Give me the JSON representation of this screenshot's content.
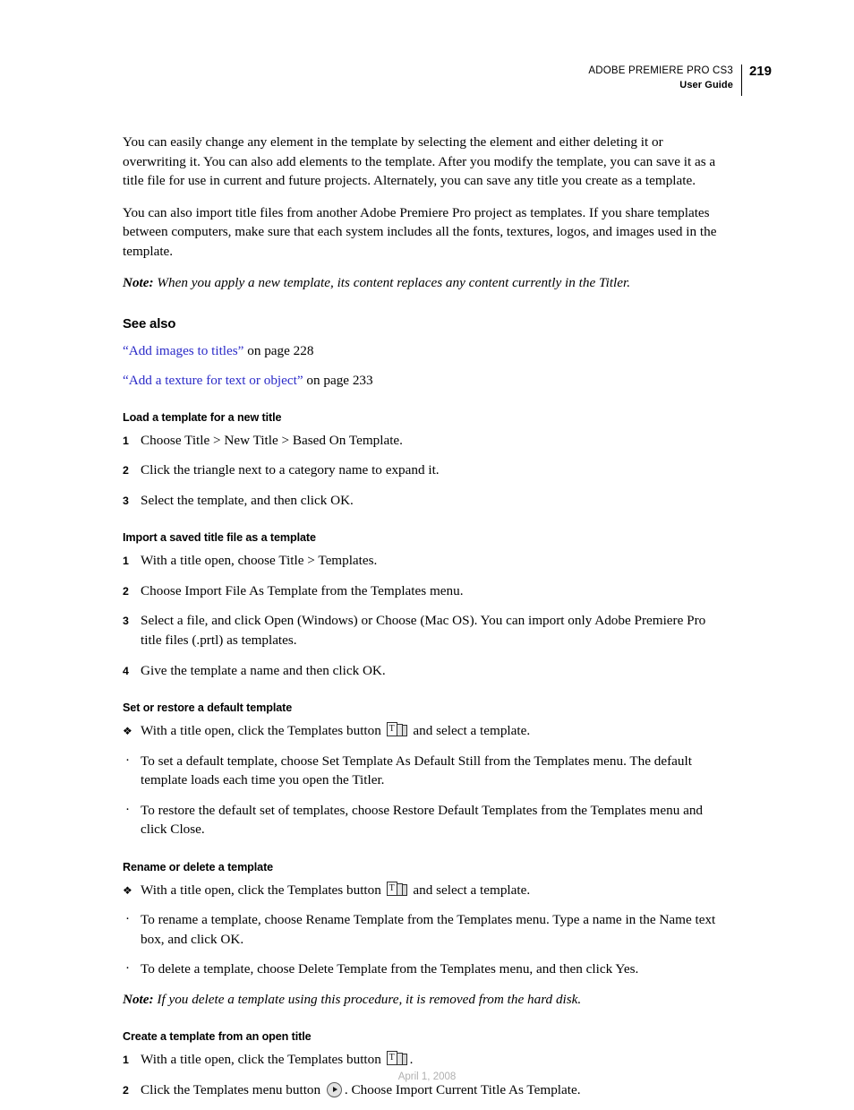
{
  "header": {
    "product": "ADOBE PREMIERE PRO CS3",
    "doc_type": "User Guide",
    "page_number": "219"
  },
  "body": {
    "paragraph_1": "You can easily change any element in the template by selecting the element and either deleting it or overwriting it. You can also add elements to the template. After you modify the template, you can save it as a title file for use in current and future projects. Alternately, you can save any title you create as a template.",
    "paragraph_2": "You can also import title files from another Adobe Premiere Pro project as templates. If you share templates between computers, make sure that each system includes all the fonts, textures, logos, and images used in the template.",
    "note_1_label": "Note:",
    "note_1_text": "When you apply a new template, its content replaces any content currently in the Titler."
  },
  "see_also": {
    "heading": "See also",
    "links": [
      {
        "open_quote": "“",
        "label": "Add images to titles",
        "close_quote": "”",
        "suffix": " on page 228"
      },
      {
        "open_quote": "“",
        "label": "Add a texture for text or object",
        "close_quote": "”",
        "suffix": " on page 233"
      }
    ]
  },
  "sections": {
    "load_template": {
      "heading": "Load a template for a new title",
      "steps": [
        {
          "num": "1",
          "text": "Choose Title > New Title > Based On Template."
        },
        {
          "num": "2",
          "text": "Click the triangle next to a category name to expand it."
        },
        {
          "num": "3",
          "text": "Select the template, and then click OK."
        }
      ]
    },
    "import_template": {
      "heading": "Import a saved title file as a template",
      "steps": [
        {
          "num": "1",
          "text": "With a title open, choose Title > Templates."
        },
        {
          "num": "2",
          "text": "Choose Import File As Template from the Templates menu."
        },
        {
          "num": "3",
          "text": "Select a file, and click Open (Windows) or Choose (Mac OS). You can import only Adobe Premiere Pro title files (.prtl) as templates."
        },
        {
          "num": "4",
          "text": "Give the template a name and then click OK."
        }
      ]
    },
    "default_template": {
      "heading": "Set or restore a default template",
      "diamond_bullet": "❖",
      "lead_text_before_icon": "With a title open, click the Templates button",
      "lead_text_after_icon": "and select a template.",
      "dot_bullet": "·",
      "bullets": [
        "To set a default template, choose Set Template As Default Still from the Templates menu. The default template loads each time you open the Titler.",
        "To restore the default set of templates, choose Restore Default Templates from the Templates menu and click Close."
      ]
    },
    "rename_delete": {
      "heading": "Rename or delete a template",
      "diamond_bullet": "❖",
      "lead_text_before_icon": "With a title open, click the Templates button",
      "lead_text_after_icon": "and select a template.",
      "dot_bullet": "·",
      "bullets": [
        "To rename a template, choose Rename Template from the Templates menu. Type a name in the Name text box, and click OK.",
        "To delete a template, choose Delete Template from the Templates menu, and then click Yes."
      ],
      "note_label": "Note:",
      "note_text": "If you delete a template using this procedure, it is removed from the hard disk."
    },
    "create_template": {
      "heading": "Create a template from an open title",
      "step_1": {
        "num": "1",
        "text_before_icon": "With a title open, click the Templates button",
        "text_after_icon": "."
      },
      "step_2": {
        "num": "2",
        "text_before_icon": "Click the Templates menu button",
        "text_after_icon": ". Choose Import Current Title As Template."
      }
    }
  },
  "icons": {
    "templates_button_letter": "T"
  },
  "footer": {
    "date": "April 1, 2008"
  },
  "colors": {
    "link": "#2a2ac8",
    "footer_text": "#b0b0b0",
    "body_text": "#000000"
  }
}
